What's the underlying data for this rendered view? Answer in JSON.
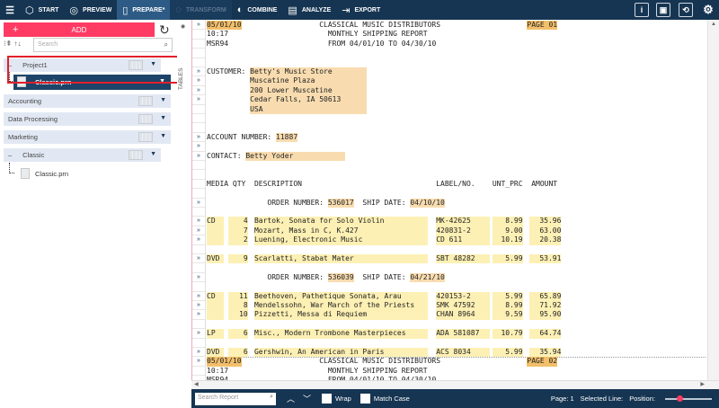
{
  "toolbar": {
    "tabs": [
      {
        "label": "START",
        "icon": "cube-icon"
      },
      {
        "label": "PREVIEW",
        "icon": "eye-icon"
      },
      {
        "label": "PREPARE*",
        "icon": "book-icon",
        "active": true
      },
      {
        "label": "TRANSFORM",
        "icon": "cycle-icon",
        "disabled": true
      },
      {
        "label": "COMBINE",
        "icon": "combine-icon"
      },
      {
        "label": "ANALYZE",
        "icon": "clipboard-icon"
      },
      {
        "label": "EXPORT",
        "icon": "export-icon"
      }
    ],
    "right_icons": [
      "info-icon",
      "window-icon",
      "book-icon",
      "gear-icon"
    ]
  },
  "sidebar": {
    "add_label": "ADD",
    "search_placeholder": "Search",
    "groups": [
      {
        "label": "Project1"
      },
      {
        "label": "Accounting"
      },
      {
        "label": "Data Processing"
      },
      {
        "label": "Marketing"
      },
      {
        "label": "Classic"
      }
    ],
    "selected_item": "Classic.prn",
    "child_item": "Classic.prn",
    "tables_label": "TABLES"
  },
  "report": {
    "page1": {
      "date": "05/01/10",
      "company": "CLASSICAL MUSIC DISTRIBUTORS",
      "page": "PAGE 01",
      "time": "10:17",
      "title": "MONTHLY SHIPPING REPORT",
      "code": "MSR94",
      "range": "FROM 04/01/10 TO 04/30/10"
    },
    "page2": {
      "date": "05/01/10",
      "company": "CLASSICAL MUSIC DISTRIBUTORS",
      "page": "PAGE 02",
      "time": "10:17",
      "title": "MONTHLY SHIPPING REPORT",
      "code": "MSR94",
      "range": "FROM 04/01/10 TO 04/30/10"
    },
    "customer_label": "CUSTOMER:",
    "customer": [
      "Betty's Music Store",
      "Muscatine Plaza",
      "200 Lower Muscatine",
      "Cedar Falls, IA 50613",
      "USA"
    ],
    "account_label": "ACCOUNT NUMBER:",
    "account": "11887",
    "contact_label": "CONTACT:",
    "contact": "Betty Yoder",
    "columns": [
      "MEDIA",
      "QTY",
      "DESCRIPTION",
      "LABEL/NO.",
      "UNT_PRC",
      "AMOUNT"
    ],
    "order_label": "ORDER NUMBER:",
    "ship_label": "SHIP DATE:",
    "orders": [
      {
        "number": "536017",
        "ship_date": "04/10/10",
        "groups": [
          [
            {
              "media": "CD",
              "qty": "4",
              "desc": "Bartok, Sonata for Solo Violin",
              "label": "MK-42625",
              "price": "8.99",
              "amount": "35.96"
            },
            {
              "media": "",
              "qty": "7",
              "desc": "Mozart, Mass in C, K.427",
              "label": "420831-2",
              "price": "9.00",
              "amount": "63.00"
            },
            {
              "media": "",
              "qty": "2",
              "desc": "Luening, Electronic Music",
              "label": "CD 611",
              "price": "10.19",
              "amount": "20.38"
            }
          ],
          [
            {
              "media": "DVD",
              "qty": "9",
              "desc": "Scarlatti, Stabat Mater",
              "label": "SBT 48282",
              "price": "5.99",
              "amount": "53.91"
            }
          ]
        ]
      },
      {
        "number": "536039",
        "ship_date": "04/21/10",
        "groups": [
          [
            {
              "media": "CD",
              "qty": "11",
              "desc": "Beethoven, Pathetique Sonata, Arau",
              "label": "420153-2",
              "price": "5.99",
              "amount": "65.89"
            },
            {
              "media": "",
              "qty": "8",
              "desc": "Mendelssohn, War March of the Priests",
              "label": "SMK 47592",
              "price": "8.99",
              "amount": "71.92"
            },
            {
              "media": "",
              "qty": "10",
              "desc": "Pizzetti, Messa di Requiem",
              "label": "CHAN 8964",
              "price": "9.59",
              "amount": "95.90"
            }
          ],
          [
            {
              "media": "LP",
              "qty": "6",
              "desc": "Misc., Modern Trombone Masterpieces",
              "label": "ADA 581087",
              "price": "10.79",
              "amount": "64.74"
            }
          ],
          [
            {
              "media": "DVD",
              "qty": "6",
              "desc": "Gershwin, An American in Paris",
              "label": "ACS 8034",
              "price": "5.99",
              "amount": "35.94"
            }
          ]
        ]
      }
    ]
  },
  "bottombar": {
    "search_placeholder": "Search Report",
    "wrap_label": "Wrap",
    "match_case_label": "Match Case",
    "page_label": "Page: 1",
    "selected_line_label": "Selected Line:",
    "position_label": "Position:",
    "position_value": 0.3
  },
  "colors": {
    "topbar": "#163552",
    "add": "#ff3b64",
    "highlight_strong": "#f2bf6b",
    "highlight_light": "#f8dcb0",
    "highlight_yellow": "#fdf0b4"
  }
}
